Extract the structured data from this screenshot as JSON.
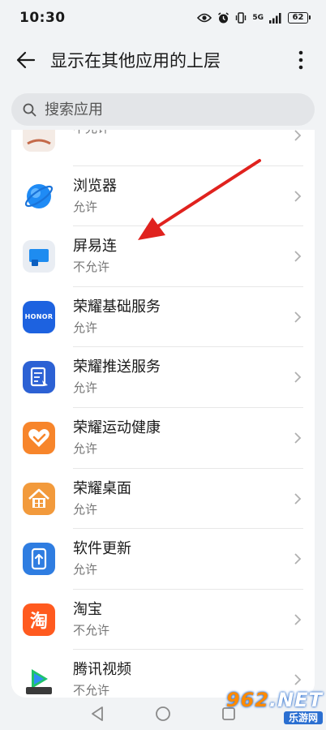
{
  "status_bar": {
    "time": "10:30",
    "network": "5G",
    "battery": "62"
  },
  "header": {
    "title": "显示在其他应用的上层"
  },
  "search": {
    "placeholder": "搜索应用"
  },
  "apps": [
    {
      "name": "",
      "status": "不允许",
      "icon": "partial-app-icon",
      "color": "#f3e9e3"
    },
    {
      "name": "浏览器",
      "status": "允许",
      "icon": "browser-icon",
      "color": "#1f8bf5"
    },
    {
      "name": "屏易连",
      "status": "不允许",
      "icon": "screen-connect-icon",
      "color": "#e9edf3"
    },
    {
      "name": "荣耀基础服务",
      "status": "允许",
      "icon": "honor-icon",
      "color": "#1d62e0"
    },
    {
      "name": "荣耀推送服务",
      "status": "允许",
      "icon": "push-service-icon",
      "color": "#2c61d4"
    },
    {
      "name": "荣耀运动健康",
      "status": "允许",
      "icon": "health-icon",
      "color": "#f7852b"
    },
    {
      "name": "荣耀桌面",
      "status": "允许",
      "icon": "home-icon",
      "color": "#f29a3c"
    },
    {
      "name": "软件更新",
      "status": "允许",
      "icon": "update-icon",
      "color": "#2f7de1"
    },
    {
      "name": "淘宝",
      "status": "不允许",
      "icon": "taobao-icon",
      "color": "#ff5a1f"
    },
    {
      "name": "腾讯视频",
      "status": "不允许",
      "icon": "tencent-video-icon",
      "color": "#ffffff"
    }
  ],
  "honor_icon_text": "HONOR",
  "taobao_icon_text": "淘",
  "watermark": {
    "top_a": "962",
    "top_b": ".NET",
    "bottom": "乐游网"
  },
  "colors": {
    "accent_arrow": "#e0221e",
    "background": "#f1f3f5",
    "card": "#ffffff"
  }
}
